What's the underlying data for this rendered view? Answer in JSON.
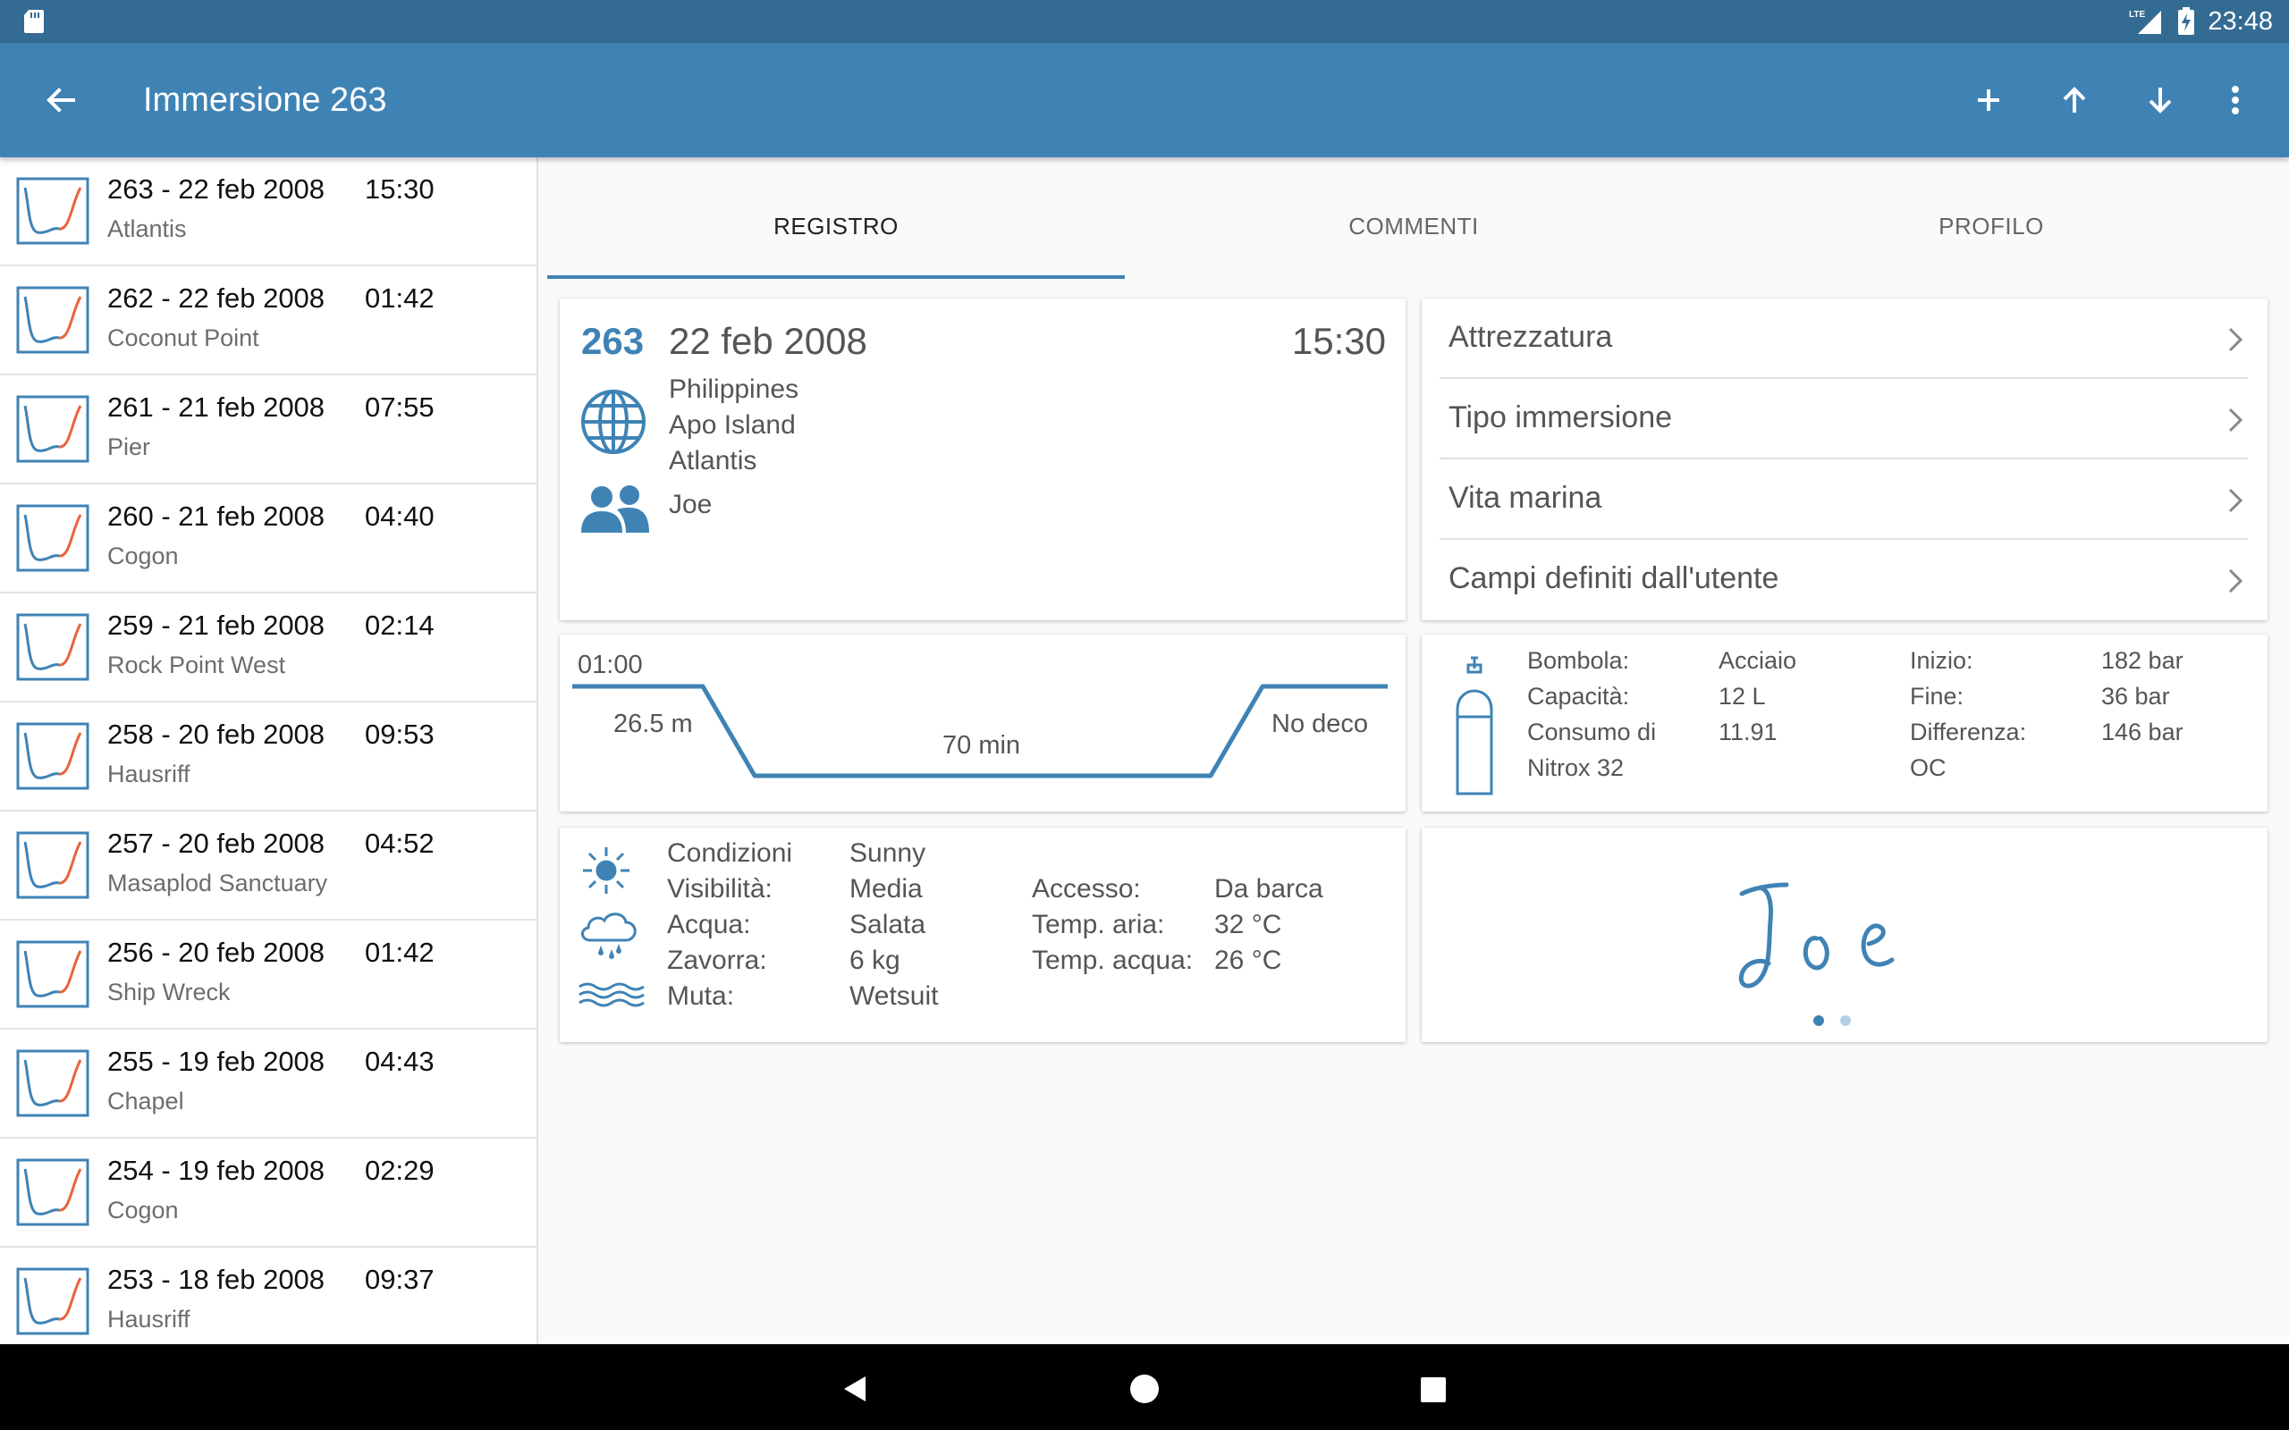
{
  "status_bar": {
    "time": "23:48",
    "icons": [
      "sd-card-icon",
      "lte-signal-icon",
      "battery-charging-icon"
    ]
  },
  "app_bar": {
    "title": "Immersione 263",
    "actions": [
      "back-arrow-icon",
      "add-icon",
      "arrow-up-icon",
      "arrow-down-icon",
      "more-vert-icon"
    ]
  },
  "dives": [
    {
      "title": "263 - 22 feb 2008",
      "time": "15:30",
      "site": "Atlantis"
    },
    {
      "title": "262 - 22 feb 2008",
      "time": "01:42",
      "site": "Coconut Point"
    },
    {
      "title": "261 - 21 feb 2008",
      "time": "07:55",
      "site": "Pier"
    },
    {
      "title": "260 - 21 feb 2008",
      "time": "04:40",
      "site": "Cogon"
    },
    {
      "title": "259 - 21 feb 2008",
      "time": "02:14",
      "site": "Rock Point West"
    },
    {
      "title": "258 - 20 feb 2008",
      "time": "09:53",
      "site": "Hausriff"
    },
    {
      "title": "257 - 20 feb 2008",
      "time": "04:52",
      "site": "Masaplod Sanctuary"
    },
    {
      "title": "256 - 20 feb 2008",
      "time": "01:42",
      "site": "Ship Wreck"
    },
    {
      "title": "255 - 19 feb 2008",
      "time": "04:43",
      "site": "Chapel"
    },
    {
      "title": "254 - 19 feb 2008",
      "time": "02:29",
      "site": "Cogon"
    },
    {
      "title": "253 - 18 feb 2008",
      "time": "09:37",
      "site": "Hausriff"
    }
  ],
  "tabs": [
    "REGISTRO",
    "COMMENTI",
    "PROFILO"
  ],
  "summary": {
    "number": "263",
    "date": "22 feb 2008",
    "time": "15:30",
    "location": [
      "Philippines",
      "Apo Island",
      "Atlantis"
    ],
    "buddy": "Joe"
  },
  "menu": [
    "Attrezzatura",
    "Tipo immersione",
    "Vita marina",
    "Campi definiti dall'utente"
  ],
  "profile": {
    "start_time": "01:00",
    "depth": "26.5 m",
    "duration": "70 min",
    "deco": "No deco"
  },
  "tank": {
    "labels": [
      "Bombola:",
      "Capacità:",
      "Consumo di",
      "Nitrox 32"
    ],
    "values": [
      "Acciaio",
      "12 L",
      "11.91",
      ""
    ],
    "labels2": [
      "Inizio:",
      "Fine:",
      "Differenza:",
      "OC"
    ],
    "values2": [
      "182 bar",
      "36 bar",
      "146 bar",
      ""
    ]
  },
  "conditions": {
    "labels": [
      "Condizioni",
      "Visibilità:",
      "Acqua:",
      "Zavorra:",
      "Muta:"
    ],
    "values": [
      "Sunny",
      "Media",
      "Salata",
      "6 kg",
      "Wetsuit"
    ],
    "labels2": [
      "Accesso:",
      "Temp. aria:",
      "Temp. acqua:"
    ],
    "values2": [
      "Da barca",
      "32 °C",
      "26 °C"
    ]
  },
  "signature": {
    "text": "Joe",
    "page_dots": 2,
    "active_dot": 0
  },
  "colors": {
    "accent": "#3f83b5",
    "status_bar": "#336b93",
    "profile_ascent": "#e8643c"
  }
}
